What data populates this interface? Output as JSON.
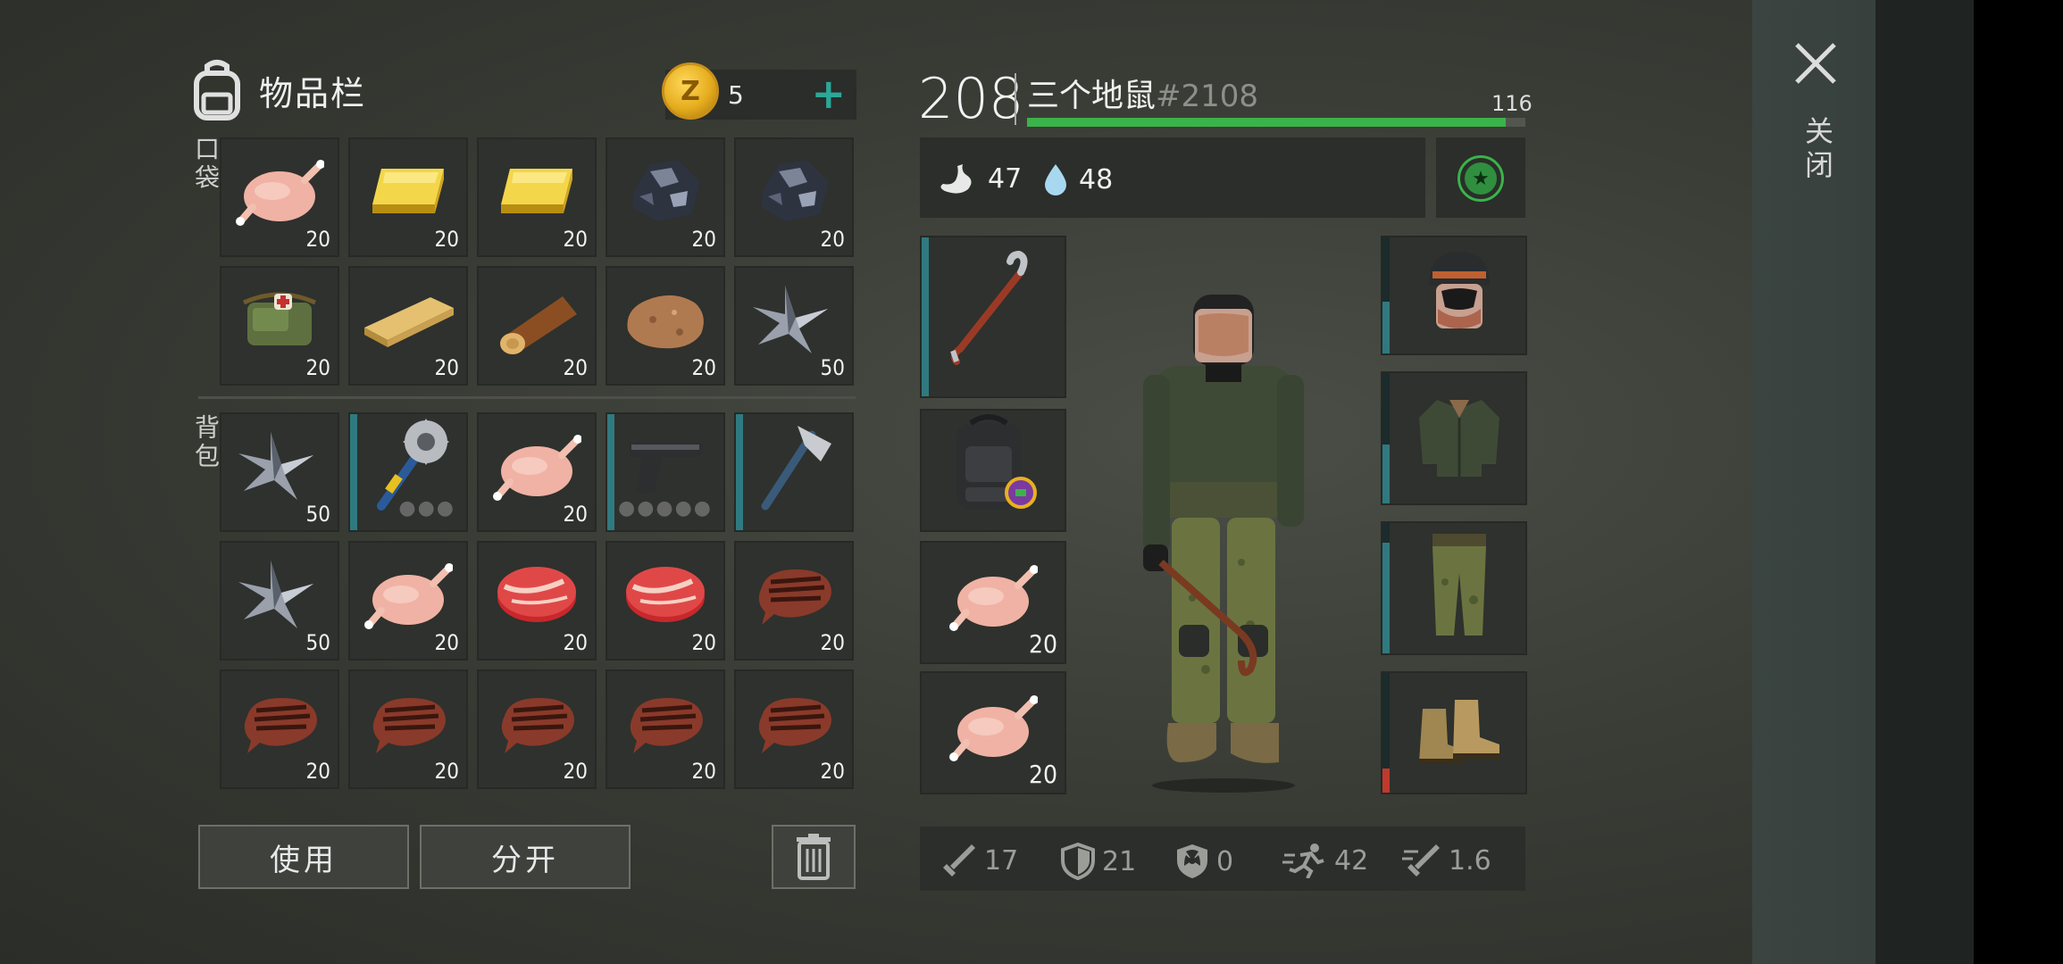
{
  "inventory": {
    "title": "物品栏",
    "coins": "5",
    "coin_symbol": "Z",
    "pockets_label": "口袋",
    "backpack_label": "背包",
    "use_label": "使用",
    "split_label": "分开"
  },
  "pockets": [
    {
      "item": "chicken",
      "qty": "20"
    },
    {
      "item": "gold-bar",
      "qty": "20"
    },
    {
      "item": "gold-bar",
      "qty": "20"
    },
    {
      "item": "iron-ore",
      "qty": "20"
    },
    {
      "item": "iron-ore",
      "qty": "20"
    },
    {
      "item": "medkit-bag",
      "qty": "20"
    },
    {
      "item": "wood-plank",
      "qty": "20"
    },
    {
      "item": "log",
      "qty": "20"
    },
    {
      "item": "stone",
      "qty": "20"
    },
    {
      "item": "scrap-metal",
      "qty": "50"
    }
  ],
  "backpack": [
    {
      "item": "scrap-metal",
      "qty": "50"
    },
    {
      "item": "saw-mace",
      "qty": "",
      "dots": "●●●"
    },
    {
      "item": "chicken",
      "qty": "20"
    },
    {
      "item": "pistol",
      "qty": "",
      "dots": "●●●●●"
    },
    {
      "item": "hatchet",
      "qty": ""
    },
    {
      "item": "scrap-metal",
      "qty": "50"
    },
    {
      "item": "chicken",
      "qty": "20"
    },
    {
      "item": "raw-steak",
      "qty": "20"
    },
    {
      "item": "raw-steak",
      "qty": "20"
    },
    {
      "item": "cooked-steak",
      "qty": "20"
    },
    {
      "item": "cooked-steak",
      "qty": "20"
    },
    {
      "item": "cooked-steak",
      "qty": "20"
    },
    {
      "item": "cooked-steak",
      "qty": "20"
    },
    {
      "item": "cooked-steak",
      "qty": "20"
    },
    {
      "item": "cooked-steak",
      "qty": "20"
    }
  ],
  "player": {
    "level": "208",
    "name": "三个地鼠",
    "id": "#2108",
    "xp_number": "116",
    "xp_fraction": 0.96,
    "hunger": "47",
    "thirst": "48"
  },
  "quick_slots": [
    {
      "item": "crowbar",
      "qty": ""
    },
    {
      "item": "backpack",
      "qty": ""
    },
    {
      "item": "chicken",
      "qty": "20"
    },
    {
      "item": "chicken",
      "qty": "20"
    }
  ],
  "combat": {
    "attack": "17",
    "armor": "21",
    "radiation": "0",
    "speed": "42",
    "attack_speed": "1.6"
  },
  "close_label": "关闭",
  "colors": {
    "accent_teal": "#2aa899",
    "xp_green": "#3ab34a",
    "durability_teal": "#2f7a80",
    "durability_red": "#c0392b"
  }
}
